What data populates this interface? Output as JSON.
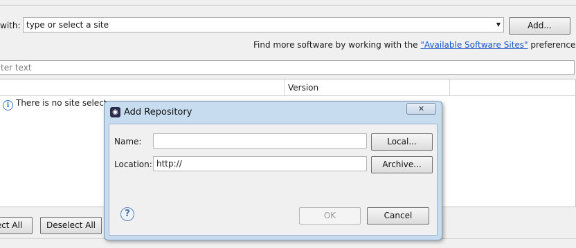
{
  "work_with": {
    "label": "with:",
    "combo_value": "type or select a site",
    "add_label": "Add..."
  },
  "find_more": {
    "prefix": "Find more software by working with the ",
    "link": "\"Available Software Sites\"",
    "suffix": " preferences."
  },
  "filter": {
    "placeholder": "ter text"
  },
  "table": {
    "headers": [
      "",
      "Version"
    ],
    "info_row": "There is no site selecte"
  },
  "buttons": {
    "select_all": "ect All",
    "deselect_all": "Deselect All"
  },
  "dialog": {
    "title": "Add Repository",
    "close_glyph": "✕",
    "name_label": "Name:",
    "name_value": "",
    "local_label": "Local...",
    "location_label": "Location:",
    "location_value": "http://",
    "archive_label": "Archive...",
    "help_glyph": "?",
    "ok_label": "OK",
    "cancel_label": "Cancel"
  },
  "icons": {
    "info": "info-icon",
    "help": "help-icon",
    "dropdown": "chevron-down-icon",
    "dialog_app": "eclipse-icon"
  }
}
